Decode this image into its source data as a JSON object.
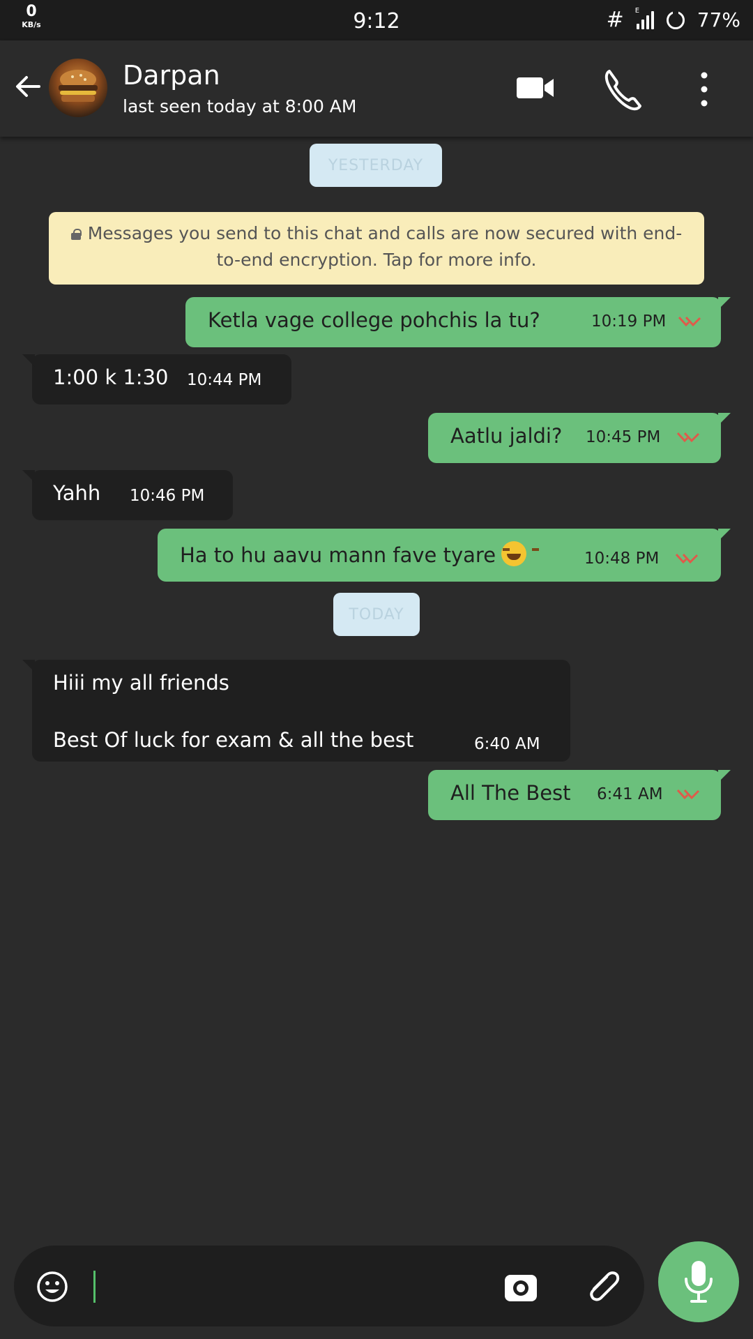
{
  "status_bar": {
    "net_speed": "0",
    "net_unit": "KB/s",
    "time": "9:12",
    "hash": "#",
    "network_type": "E",
    "battery": "77%"
  },
  "header": {
    "contact_name": "Darpan",
    "last_seen": "last seen today at 8:00 AM",
    "icons": [
      "arrow-left-icon",
      "video-camera-icon",
      "phone-icon",
      "more-vert-icon"
    ]
  },
  "chat": {
    "date_yesterday": "YESTERDAY",
    "encryption_notice": "Messages you send to this chat and calls are now secured with end-to-end encryption. Tap for more info.",
    "date_today": "TODAY",
    "messages": [
      {
        "dir": "out",
        "text": "Ketla vage college pohchis la tu?",
        "time": "10:19 PM"
      },
      {
        "dir": "in",
        "text": "1:00 k 1:30",
        "time": "10:44 PM"
      },
      {
        "dir": "out",
        "text": "Aatlu jaldi?",
        "time": "10:45 PM"
      },
      {
        "dir": "in",
        "text": "Yahh",
        "time": "10:46 PM"
      },
      {
        "dir": "out",
        "text": "Ha to hu aavu mann fave tyare",
        "emoji": "face-with-tears-of-joy",
        "time": "10:48 PM"
      },
      {
        "dir": "in",
        "line1": "Hiii my all friends",
        "line2": "Best Of luck for exam & all the best",
        "time": "6:40 AM"
      },
      {
        "dir": "out",
        "text": "All The Best",
        "time": "6:41 AM"
      }
    ],
    "read_tick_color": "#e05a4a"
  },
  "input_bar": {
    "placeholder": "",
    "icons": [
      "emoji-icon",
      "camera-icon",
      "attach-icon",
      "mic-icon"
    ]
  },
  "colors": {
    "background": "#2b2b2b",
    "outgoing_bubble": "#6bc07c",
    "incoming_bubble": "#1f1f1f",
    "encryption_notice": "#f9edba",
    "date_chip": "#d5e9f3",
    "accent": "#6bc07c"
  }
}
